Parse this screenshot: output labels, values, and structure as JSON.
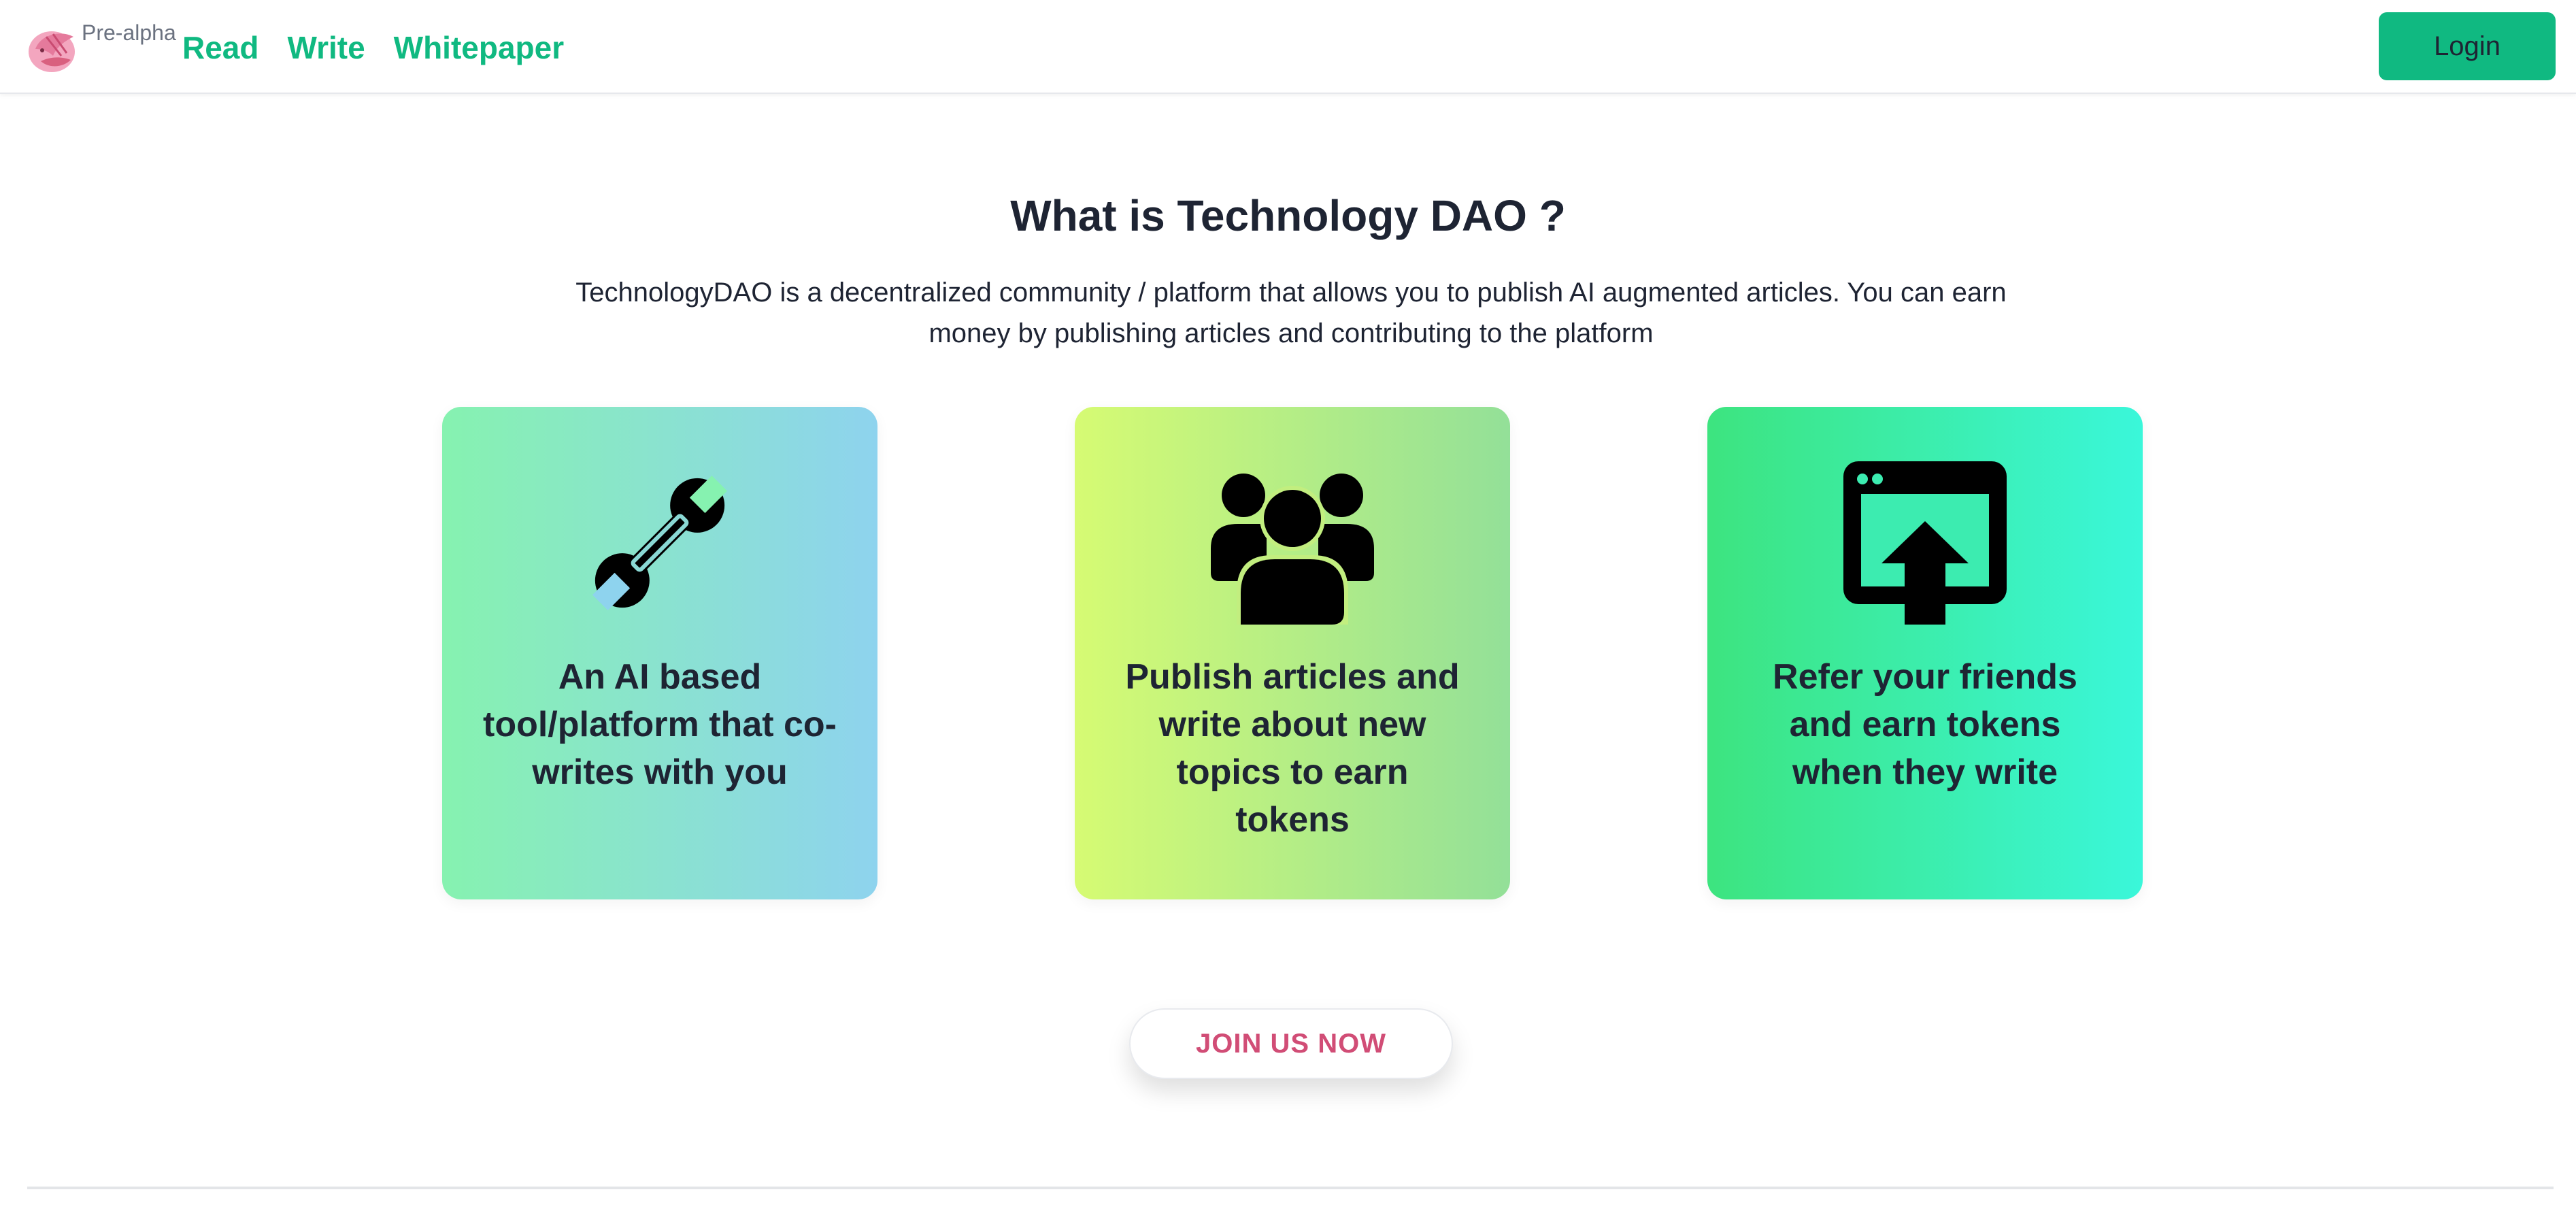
{
  "header": {
    "logo_icon": "bird-logo-icon",
    "badge": "Pre-alpha",
    "nav": [
      {
        "label": "Read"
      },
      {
        "label": "Write"
      },
      {
        "label": "Whitepaper"
      }
    ],
    "login_label": "Login"
  },
  "hero": {
    "title": "What is Technology DAO ?",
    "description": "TechnologyDAO is a decentralized community / platform that allows you to publish AI augmented articles. You can earn money by publishing articles and contributing to the platform"
  },
  "cards": [
    {
      "icon": "wrench-icon",
      "text": "An AI based tool/platform that co-writes with you"
    },
    {
      "icon": "users-group-icon",
      "text": "Publish articles and write about new topics to earn tokens"
    },
    {
      "icon": "share-upload-icon",
      "text": "Refer your friends and earn tokens when they write"
    }
  ],
  "cta": {
    "label": "JOIN US NOW"
  },
  "colors": {
    "accent": "#10b981",
    "text": "#1e2433",
    "cta_text": "#d14d76",
    "card1_gradient": [
      "#86f2b0",
      "#8ed3ee"
    ],
    "card2_gradient": [
      "#d6fb73",
      "#93e098"
    ],
    "card3_gradient": [
      "#3de47f",
      "#3af7da"
    ]
  }
}
